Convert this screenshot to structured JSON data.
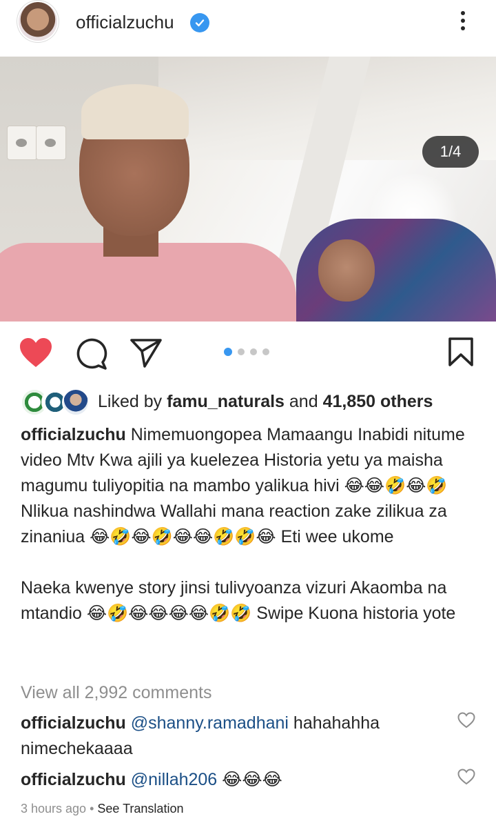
{
  "header": {
    "username": "officialzuchu",
    "verified": true
  },
  "media": {
    "counter": "1/4",
    "total_slides": 4,
    "active_slide": 1
  },
  "actions": {
    "liked": true,
    "like_color": "#ed4956"
  },
  "likes": {
    "prefix": "Liked by ",
    "first_user": "famu_naturals",
    "conjunction": " and ",
    "others": "41,850 others"
  },
  "caption": {
    "username": "officialzuchu",
    "text": " Nimemuongopea  Mamaangu Inabidi nitume video Mtv Kwa ajili ya kuelezea Historia yetu ya maisha magumu tuliyopitia na mambo yalikua hivi 😂😂🤣😂🤣 Nlikua nashindwa Wallahi mana reaction zake zilikua za zinaniua 😂🤣😂🤣😂😂🤣🤣😂 Eti wee ukome",
    "text2": "Naeka kwenye story jinsi tulivyoanza vizuri  Akaomba na mtandio 😂🤣😂😂😂😂🤣🤣 Swipe Kuona historia yote"
  },
  "view_all": "View all 2,992 comments",
  "comments": [
    {
      "user": "officialzuchu",
      "mention": "@shanny.ramadhani",
      "text": " hahahahha nimechekaaaa"
    },
    {
      "user": "officialzuchu",
      "mention": "@nillah206",
      "text": " 😂😂😂"
    }
  ],
  "meta": {
    "time": "3 hours ago",
    "separator": " • ",
    "translate": "See Translation"
  },
  "colors": {
    "accent_blue": "#3897f0",
    "text": "#262626",
    "muted": "#8e8e8e"
  }
}
